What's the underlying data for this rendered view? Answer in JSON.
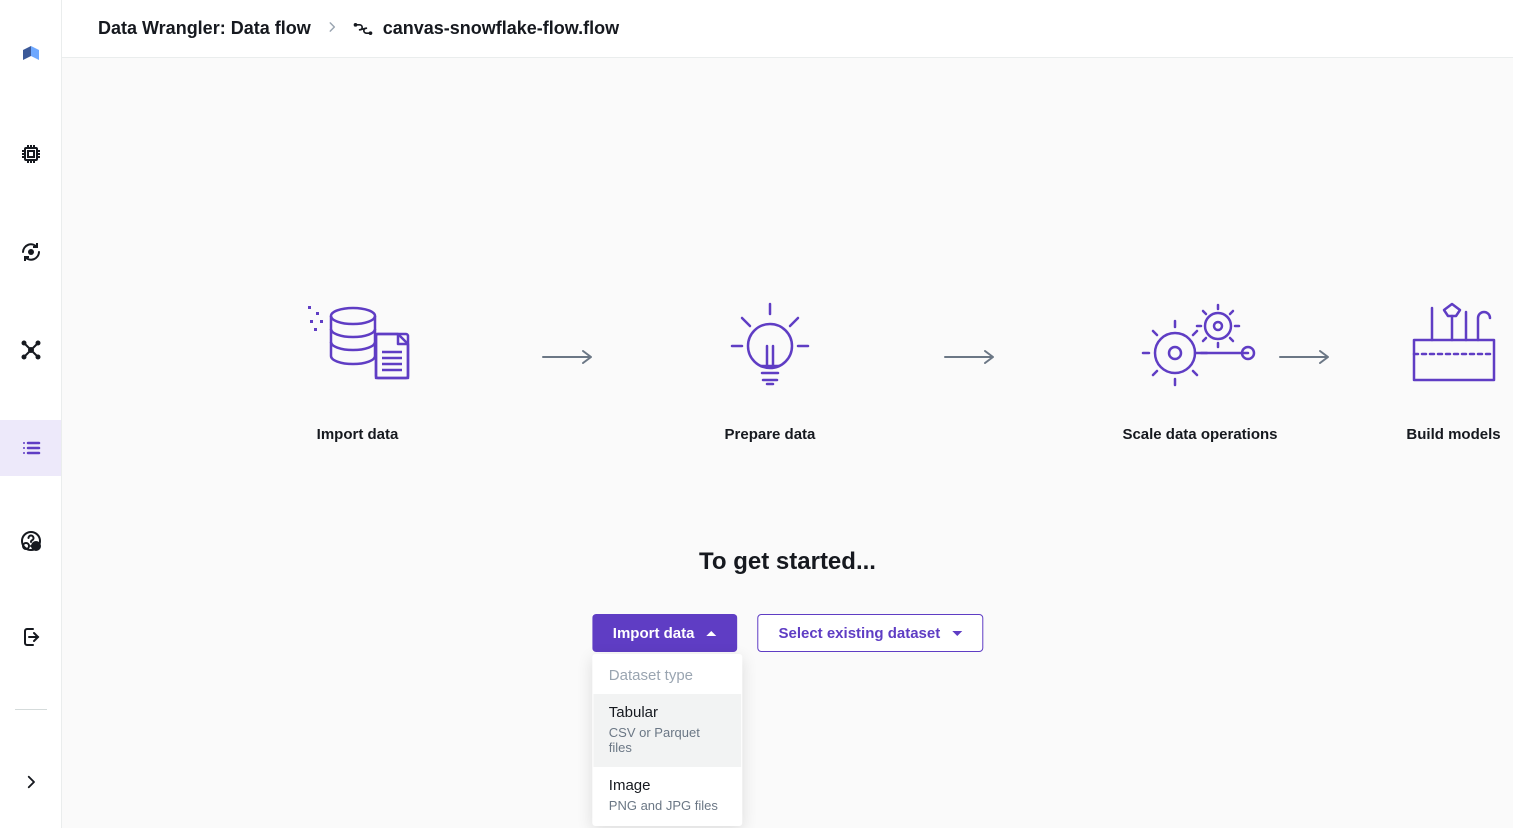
{
  "breadcrumb": {
    "root": "Data Wrangler: Data flow",
    "file": "canvas-snowflake-flow.flow"
  },
  "steps": {
    "import": "Import data",
    "prepare": "Prepare data",
    "scale": "Scale data operations",
    "build": "Build models"
  },
  "get_started": {
    "title": "To get started...",
    "import_btn": "Import data",
    "select_btn": "Select existing dataset"
  },
  "dropdown": {
    "header": "Dataset type",
    "items": [
      {
        "title": "Tabular",
        "sub": "CSV or Parquet files"
      },
      {
        "title": "Image",
        "sub": "PNG and JPG files"
      }
    ]
  }
}
